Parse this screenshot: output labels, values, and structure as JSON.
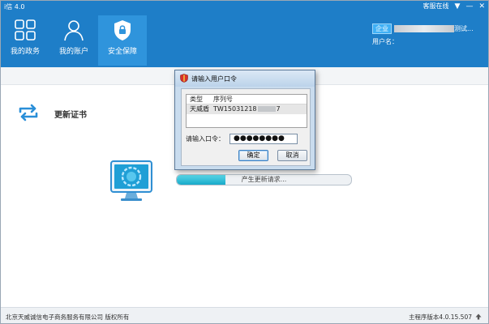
{
  "window": {
    "title": "i信 4.0",
    "service": "客服在线",
    "service_arrow": "▼",
    "minimize": "—",
    "close": "✕"
  },
  "nav": [
    {
      "label": "我的政务",
      "icon": "grid-icon"
    },
    {
      "label": "我的账户",
      "icon": "user-icon"
    },
    {
      "label": "安全保障",
      "icon": "shield-icon"
    }
  ],
  "user": {
    "enterprise_badge": "企业",
    "enterprise_name_suffix": "测试...",
    "username_label": "用户名："
  },
  "section": {
    "title": "更新证书",
    "icon": "refresh-icon"
  },
  "progress": {
    "text": "产生更新请求...",
    "fraction": 0.28
  },
  "dialog": {
    "title": "请输入用户口令",
    "columns": [
      "类型",
      "序列号"
    ],
    "rows": [
      {
        "type": "天威盾",
        "serial_prefix": "TW15031218",
        "serial_suffix": "7"
      }
    ],
    "password_label": "请输入口令：",
    "password_value": "●●●●●●●●",
    "ok_label": "确定",
    "cancel_label": "取消"
  },
  "footer": {
    "copyright": "北京天威诚信电子商务服务有限公司 版权所有",
    "version": "主程序版本4.0.15.507"
  },
  "colors": {
    "header_blue": "#1e7ec8",
    "active_nav": "#2f94dc",
    "progress": "#17a9c9"
  }
}
